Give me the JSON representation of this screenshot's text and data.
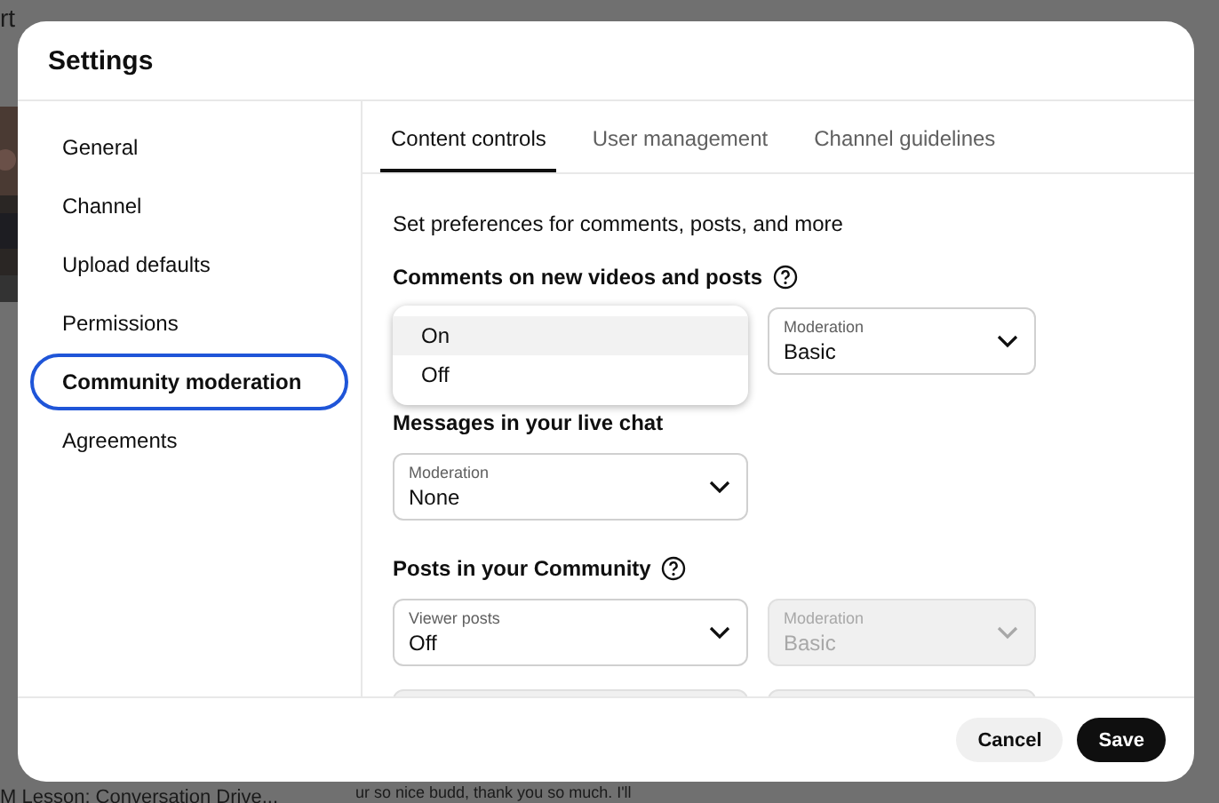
{
  "background": {
    "texts": [
      {
        "text": "rt"
      },
      {
        "text": "M Lesson: Conversation Drive..."
      },
      {
        "text": "ur so nice budd, thank you so much. I'll"
      }
    ]
  },
  "window": {
    "title": "Settings"
  },
  "sidebar": {
    "items": [
      {
        "label": "General",
        "selected": false
      },
      {
        "label": "Channel",
        "selected": false
      },
      {
        "label": "Upload defaults",
        "selected": false
      },
      {
        "label": "Permissions",
        "selected": false
      },
      {
        "label": "Community moderation",
        "selected": true
      },
      {
        "label": "Agreements",
        "selected": false
      }
    ]
  },
  "tabs": [
    {
      "label": "Content controls",
      "selected": true
    },
    {
      "label": "User management",
      "selected": false
    },
    {
      "label": "Channel guidelines",
      "selected": false
    }
  ],
  "content": {
    "intro": "Set preferences for comments, posts, and more",
    "sections": [
      {
        "title": "Comments on new videos and posts",
        "help": true,
        "controls": [
          {
            "kind": "menu",
            "options": [
              {
                "label": "On",
                "selected": true
              },
              {
                "label": "Off",
                "selected": false
              }
            ]
          },
          {
            "kind": "select",
            "label": "Moderation",
            "value": "Basic",
            "disabled": false
          }
        ]
      },
      {
        "title": "Messages in your live chat",
        "help": false,
        "controls": [
          {
            "kind": "select",
            "label": "Moderation",
            "value": "None",
            "disabled": false
          }
        ]
      },
      {
        "title": "Posts in your Community",
        "help": true,
        "controls": [
          {
            "kind": "select",
            "label": "Viewer posts",
            "value": "Off",
            "disabled": false
          },
          {
            "kind": "select",
            "label": "Moderation",
            "value": "Basic",
            "disabled": true
          },
          {
            "kind": "cut",
            "disabled": true
          },
          {
            "kind": "cut",
            "disabled": true
          }
        ]
      }
    ]
  },
  "buttons": [
    {
      "label": "Cancel",
      "kind": "secondary"
    },
    {
      "label": "Save",
      "kind": "primary"
    }
  ]
}
